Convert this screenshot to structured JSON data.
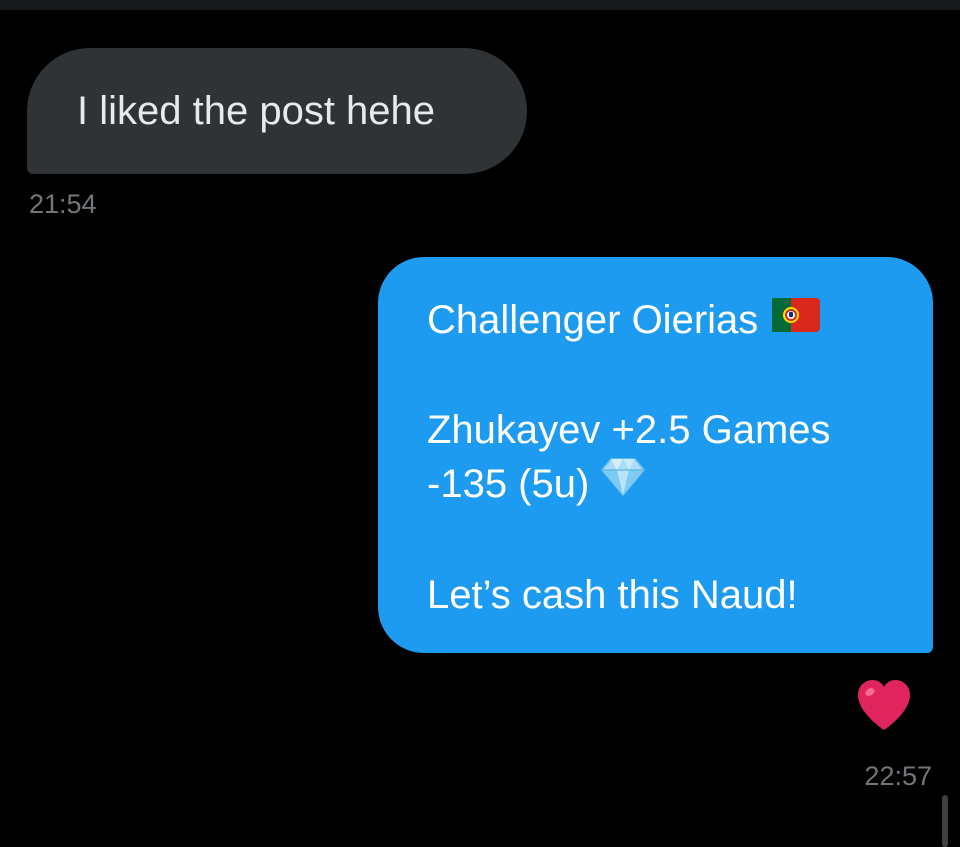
{
  "conversation": {
    "messages": [
      {
        "direction": "received",
        "text": "I liked the post hehe",
        "time": "21:54"
      },
      {
        "direction": "sent",
        "lines": [
          "Challenger Oierias",
          "Zhukayev +2.5 Games",
          "-135 (5u)",
          "Let’s cash this Naud!"
        ],
        "emojis": [
          "portugal-flag-icon",
          "gem-icon"
        ],
        "reaction": "heart-icon",
        "time": "22:57"
      }
    ]
  },
  "colors": {
    "background": "#000000",
    "received_bubble": "#2f3336",
    "sent_bubble": "#1d9bf0",
    "timestamp": "#71767b",
    "heart": "#e0245e"
  }
}
